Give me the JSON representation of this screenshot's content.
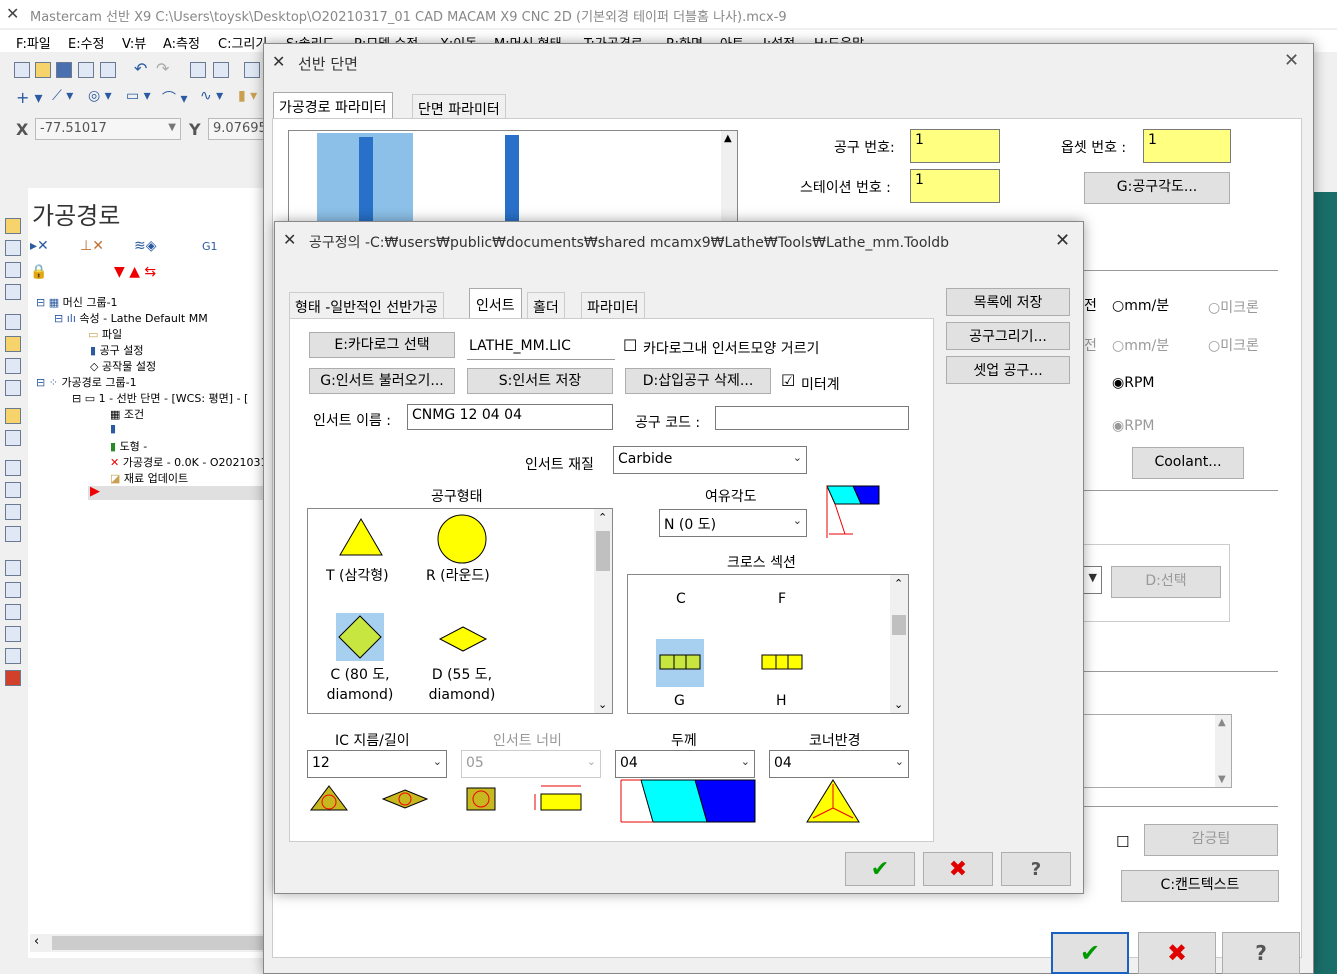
{
  "app": {
    "title": "Mastercam 선반 X9  C:\\Users\\toysk\\Desktop\\O20210317_01 CAD MACAM X9 CNC 2D (기본외경 테이퍼 더블홈 나사).mcx-9",
    "menu": [
      "F:파일",
      "E:수정",
      "V:뷰",
      "A:측정",
      "C:그리기",
      "S:솔리드",
      "P:모델 수정",
      "X:이동",
      "M:머신 형태",
      "T:가공경로",
      "R:화면",
      "아트",
      "I:설정",
      "H:도움말"
    ],
    "coord_x_label": "X",
    "coord_x_value": "-77.51017",
    "coord_y_label": "Y",
    "coord_y_value": "9.07695"
  },
  "manager": {
    "title": "가공경로",
    "g1": "G1",
    "tree": [
      "머신 그룹-1",
      "속성 - Lathe Default MM",
      "파일",
      "공구 설정",
      "공작물 설정",
      "가공경로 그룹-1",
      "1 - 선반 단면 - [WCS: 평면] - [",
      "조건",
      "도형 -",
      "가공경로 - 0.0K - O2021031",
      "재료 업데이트"
    ]
  },
  "outer": {
    "title": "선반 단면",
    "tabs": [
      "가공경로 파라미터",
      "단면 파라미터"
    ],
    "tool_no_label": "공구 번호:",
    "tool_no": "1",
    "offset_no_label": "옵셋 번호 :",
    "offset_no": "1",
    "station_label": "스테이션 번호 :",
    "station_no": "1",
    "tool_angle_btn": "G:공구각도...",
    "jeon1": "전",
    "jeon2": "전",
    "mm_min": "mm/분",
    "micron": "미크론",
    "mm_min2": "mm/분",
    "micron2": "미크론",
    "rpm": "RPM",
    "rpm2": "RPM",
    "coolant_btn": "Coolant...",
    "d_choice": "D:선택",
    "adv_btn": "감긍팀",
    "canned_btn": "C:캔드텍스트"
  },
  "inner": {
    "title": "공구정의 -C:₩users₩public₩documents₩shared mcamx9₩Lathe₩Tools₩Lathe_mm.Tooldb",
    "tabs": [
      "형태 -일반적인 선반가공",
      "인서트",
      "홀더",
      "파라미터"
    ],
    "side_buttons": [
      "목록에 저장",
      "공구그리기...",
      "셋업 공구..."
    ],
    "catalog_btn": "E:카다로그 선택",
    "catalog_file": "LATHE_MM.LIC",
    "catalog_filter_label": "카다로그내 인서트모양 거르기",
    "get_insert_btn": "G:인서트 불러오기...",
    "save_insert_btn": "S:인서트 저장",
    "delete_insert_btn": "D:삽입공구 삭제...",
    "metric_label": "미터계",
    "metric_checked": true,
    "insert_name_label": "인서트 이름 :",
    "insert_name": "CNMG 12 04 04",
    "tool_code_label": "공구 코드 :",
    "tool_code": "",
    "material_label": "인서트 재질",
    "material": "Carbide",
    "shape_label": "공구형태",
    "shapes": [
      {
        "name": "T (삼각형)",
        "selected": false
      },
      {
        "name": "R (라운드)",
        "selected": false
      },
      {
        "name": "C (80 도, diamond)",
        "selected": true
      },
      {
        "name": "D (55 도, diamond)",
        "selected": false
      }
    ],
    "relief_label": "여유각도",
    "relief": "N (0 도)",
    "cross_label": "크로스 섹션",
    "cross": [
      {
        "name": "C",
        "selected": false
      },
      {
        "name": "F",
        "selected": false
      },
      {
        "name": "G",
        "selected": true
      },
      {
        "name": "H",
        "selected": false
      }
    ],
    "ic_label": "IC 지름/길이",
    "ic": "12",
    "width_label": "인서트 너비",
    "width": "05",
    "thickness_label": "두께",
    "thickness": "04",
    "radius_label": "코너반경",
    "radius": "04",
    "colors": {
      "yellow": "#ffff00",
      "cyan": "#00ffff",
      "blue": "#0000ff",
      "select": "#a6cff0",
      "red": "#e00000",
      "green": "#009a00"
    }
  }
}
